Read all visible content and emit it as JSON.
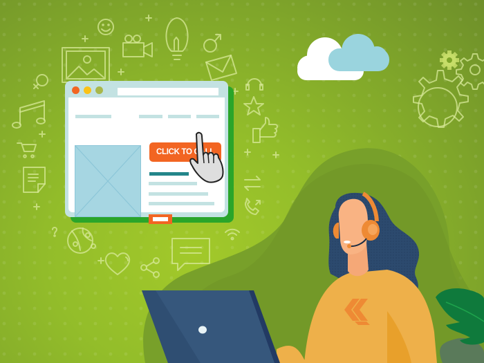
{
  "scene": {
    "title": "Click to call customer support illustration",
    "palette": {
      "background_light": "#a2c92a",
      "background_dark": "#6e8f2a",
      "browser_frame": "#c3e2e2",
      "browser_shadow": "#2aa52a",
      "cta_orange": "#f26522",
      "accent_teal": "#23868a",
      "image_placeholder": "#a6d6e2",
      "hair_navy": "#2c4a6e",
      "skin": "#f9b383",
      "headset_orange": "#ee8a34",
      "sweater_yellow": "#eeb04a",
      "laptop_blue": "#36577c",
      "cloud_white": "#ffffff",
      "cloud_blue": "#9ad4de",
      "leaf_green": "#0f7a3c"
    }
  },
  "browser_mockup": {
    "window_dots": [
      "red-dot",
      "yellow-dot",
      "olive-dot"
    ],
    "dot_colors": [
      "#f26522",
      "#fbc216",
      "#a9b84a"
    ],
    "cta_button_label": "CLICK TO CALL"
  },
  "icons": [
    "smiley-icon",
    "video-camera-icon",
    "lightbulb-icon",
    "male-symbol-icon",
    "image-icon",
    "female-symbol-icon",
    "envelope-icon",
    "music-note-icon",
    "headset-icon",
    "star-icon",
    "thumbs-up-icon",
    "shopping-cart-icon",
    "document-icon",
    "transfer-arrows-icon",
    "phone-callback-icon",
    "question-mark-icon",
    "globe-network-icon",
    "heart-icon",
    "share-icon",
    "chat-bubble-icon",
    "wifi-icon",
    "gear-small-icon",
    "gear-medium-icon",
    "gear-large-icon"
  ]
}
